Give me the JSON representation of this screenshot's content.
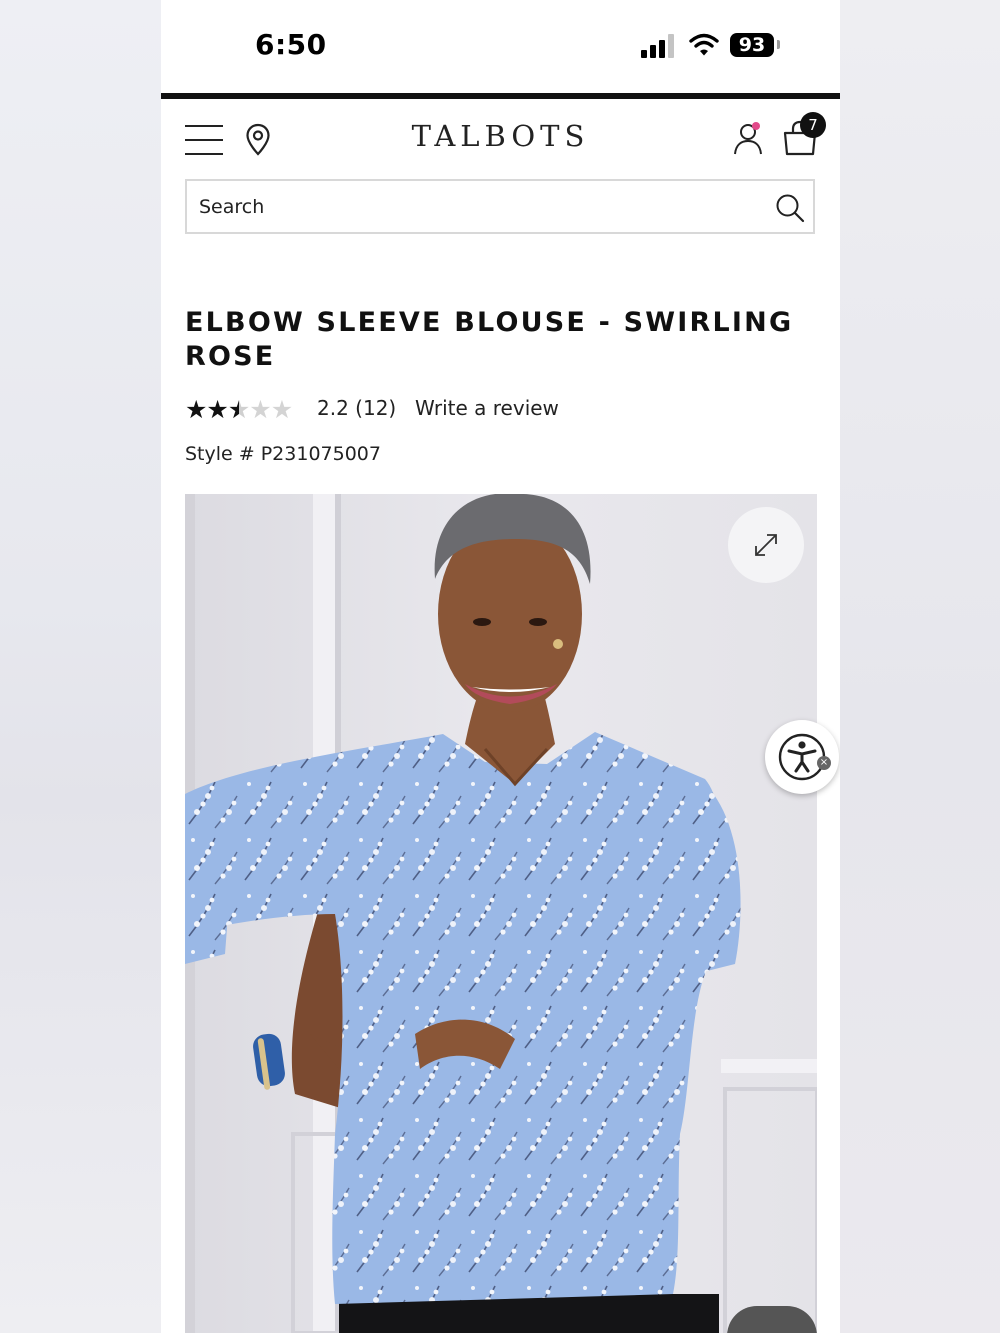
{
  "status_bar": {
    "time": "6:50",
    "battery": "93",
    "icons": [
      "signal-icon",
      "wifi-icon",
      "battery-icon"
    ]
  },
  "header": {
    "logo": "TALBOTS",
    "cart_count": "7",
    "icons": [
      "menu-icon",
      "location-pin-icon",
      "account-icon",
      "shopping-bag-icon"
    ]
  },
  "search": {
    "placeholder": "Search",
    "icon": "search-icon"
  },
  "product": {
    "title": "ELBOW SLEEVE BLOUSE - SWIRLING ROSE",
    "rating": {
      "stars": 2.2,
      "max_stars": 5,
      "label": "2.2 (12)"
    },
    "write_review_label": "Write a review",
    "style_number": "Style # P231075007",
    "image": {
      "description_icon": "expand-icon",
      "top_color": "#8fb0e0"
    }
  },
  "floating": {
    "accessibility_icon": "accessibility-icon",
    "accessibility_close": "×"
  },
  "colors": {
    "text": "#111111",
    "accent_dot": "#e24a8a",
    "blouse_blue": "#9ab8e6"
  }
}
